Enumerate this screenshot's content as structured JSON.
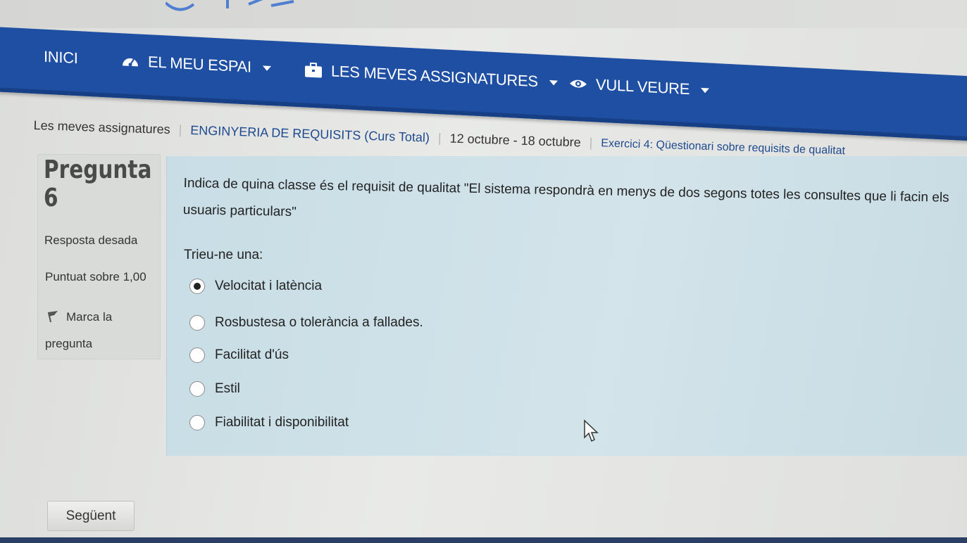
{
  "navbar": {
    "home": "INICI",
    "my_space": "EL MEU ESPAI",
    "my_courses": "LES MEVES ASSIGNATURES",
    "i_want_to_see": "VULL VEURE"
  },
  "breadcrumb": {
    "items": [
      "Les meves assignatures",
      "ENGINYERIA DE REQUISITS (Curs Total)",
      "12 octubre - 18 octubre",
      "Exercici 4: Qüestionari sobre requisits de qualitat"
    ]
  },
  "question_info": {
    "title_word": "Pregunta",
    "number": "6",
    "state": "Resposta desada",
    "grade": "Puntuat sobre 1,00",
    "flag_label_line1": "Marca la",
    "flag_label_line2": "pregunta"
  },
  "question": {
    "text": "Indica de quina classe és el requisit de qualitat \"El sistema respondrà en menys de dos segons totes les consultes que li facin els usuaris particulars\"",
    "prompt": "Trieu-ne una:",
    "options": [
      {
        "label": "Velocitat i latència",
        "selected": true
      },
      {
        "label": "Rosbustesa o tolerància a fallades.",
        "selected": false
      },
      {
        "label": "Facilitat d'ús",
        "selected": false
      },
      {
        "label": "Estil",
        "selected": false
      },
      {
        "label": "Fiabilitat i disponibilitat",
        "selected": false
      }
    ]
  },
  "footer": {
    "next_button": "Següent"
  },
  "colors": {
    "navbar": "#1f4fa3",
    "link": "#1d4a8f",
    "question_bg": "#d3e4ea",
    "info_bg": "#d9dbd9"
  }
}
